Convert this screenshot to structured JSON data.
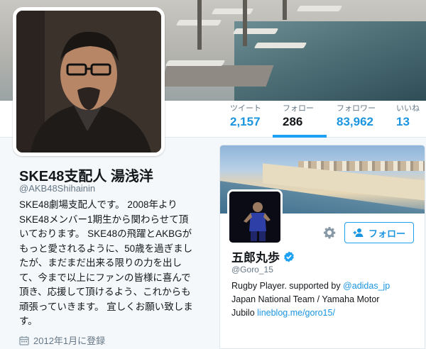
{
  "profile": {
    "name": "SKE48支配人 湯浅洋",
    "handle": "@AKB48Shihainin",
    "bio_lines": [
      "SKE48劇場支配人です。 2008年より",
      "SKE48メンバー1期生から関わらせて頂",
      "いております。 SKE48の飛躍とAKBGが",
      "もっと愛されるように、50歳を過ぎまし",
      "たが、まだまだ出来る限りの力を出し",
      "て、今まで以上にファンの皆様に喜んで",
      "頂き、応援して頂けるよう、これからも",
      "頑張っていきます。 宜しくお願い致しま",
      "す。"
    ],
    "joined": "2012年1月に登録"
  },
  "stats": [
    {
      "label": "ツイート",
      "value": "2,157"
    },
    {
      "label": "フォロー",
      "value": "286"
    },
    {
      "label": "フォロワー",
      "value": "83,962"
    },
    {
      "label": "いいね",
      "value": "13"
    }
  ],
  "card": {
    "name": "五郎丸歩",
    "handle": "@Goro_15",
    "follow_label": "フォロー",
    "bio_line1_text": "Rugby Player. supported by ",
    "bio_line1_link": "@adidas_jp",
    "bio_line2": "Japan National Team / Yamaha Motor",
    "bio_line3_text": "Jubilo ",
    "bio_line3_link": "lineblog.me/goro15/"
  },
  "icons": {
    "calendar": "calendar-icon",
    "verified": "verified-badge-icon",
    "gear": "gear-icon",
    "follow": "add-person-icon"
  },
  "colors": {
    "accent": "#1da1f2",
    "link": "#1b95e0",
    "text": "#14171a",
    "muted": "#657786"
  }
}
